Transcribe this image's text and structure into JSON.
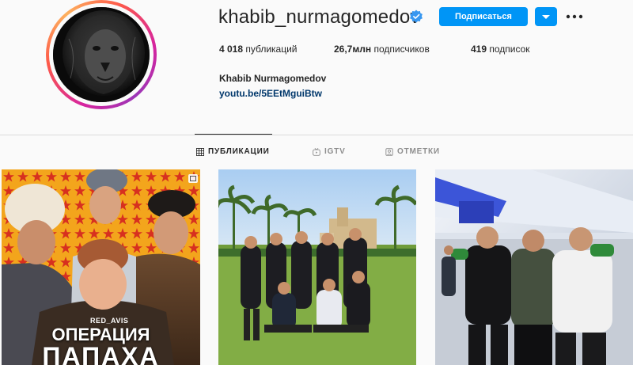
{
  "profile": {
    "username": "khabib_nurmagomedov",
    "full_name": "Khabib Nurmagomedov",
    "bio_link": "youtu.be/5EEtMguiBtw",
    "verified": true,
    "verified_icon": "verified-badge-icon",
    "avatar_icon": "lion-avatar"
  },
  "actions": {
    "follow_label": "Подписаться",
    "dropdown_icon": "chevron-down-icon",
    "more_icon": "more-dots-icon"
  },
  "stats": {
    "posts_count": "4 018",
    "posts_label": "публикаций",
    "followers_count": "26,7млн",
    "followers_label": "подписчиков",
    "following_count": "419",
    "following_label": "подписок"
  },
  "tabs": [
    {
      "label": "ПУБЛИКАЦИИ",
      "icon": "grid-icon",
      "active": true
    },
    {
      "label": "IGTV",
      "icon": "igtv-icon",
      "active": false
    },
    {
      "label": "ОТМЕТКИ",
      "icon": "tagged-icon",
      "active": false
    }
  ],
  "posts": [
    {
      "caption_line1": "ОПЕРАЦИЯ",
      "caption_line2": "ПАПАХА",
      "watermark": "RED_AVIS",
      "type_icon": "multi-photo-icon"
    },
    {
      "type_icon": ""
    },
    {
      "type_icon": ""
    }
  ],
  "colors": {
    "accent": "#0095f6",
    "link": "#00376b",
    "text": "#262626",
    "muted": "#8e8e8e",
    "divider": "#dbdbdb",
    "background": "#fafafa"
  }
}
